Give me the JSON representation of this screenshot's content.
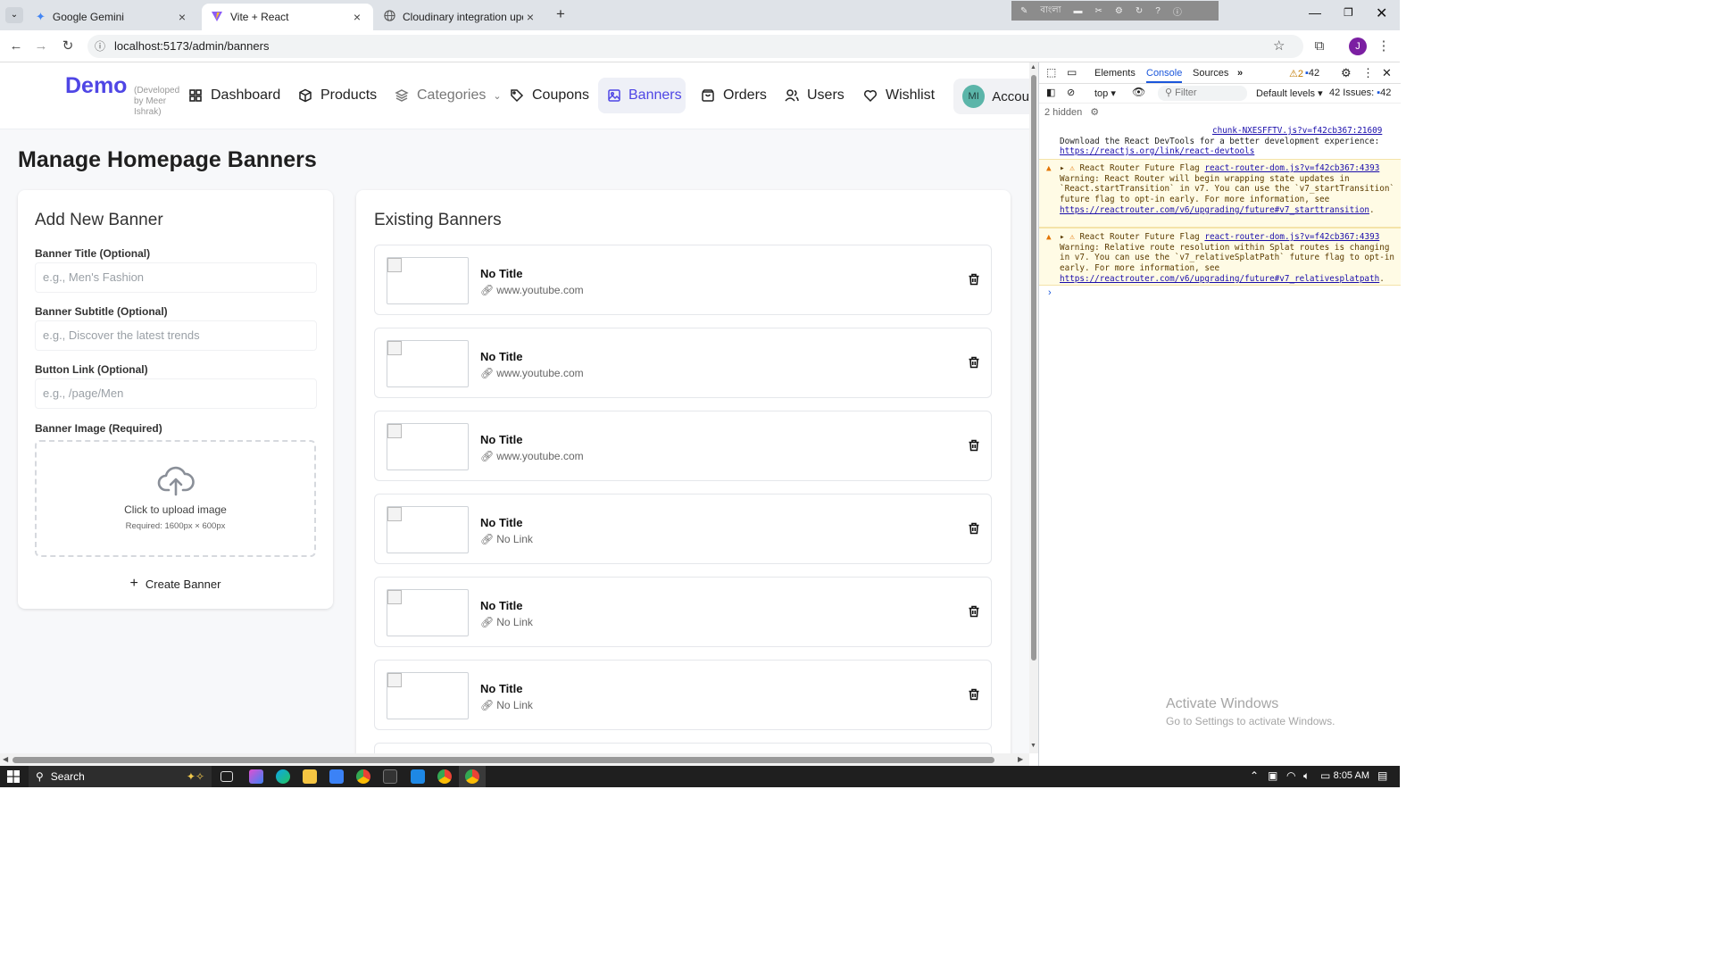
{
  "browser": {
    "tabs": [
      {
        "title": "Google Gemini",
        "active": false
      },
      {
        "title": "Vite + React",
        "active": true
      },
      {
        "title": "Cloudinary integration update",
        "active": false
      }
    ],
    "url": "localhost:5173/admin/banners",
    "profile_initial": "J",
    "lang_label": "বাংলা"
  },
  "app": {
    "brand": "Demo",
    "brand_sub": "(Developed by Meer Ishrak)",
    "nav": [
      {
        "label": "Dashboard",
        "icon": "grid-icon"
      },
      {
        "label": "Products",
        "icon": "box-icon"
      },
      {
        "label": "Categories",
        "icon": "layers-icon"
      },
      {
        "label": "Coupons",
        "icon": "tag-icon"
      },
      {
        "label": "Banners",
        "icon": "image-icon",
        "active": true
      },
      {
        "label": "Orders",
        "icon": "bag-icon"
      },
      {
        "label": "Users",
        "icon": "users-icon"
      },
      {
        "label": "Wishlist",
        "icon": "heart-icon"
      }
    ],
    "account_initials": "MI",
    "account_label": "Accou",
    "page_title": "Manage Homepage Banners",
    "accent": "#4f46e5"
  },
  "form": {
    "heading": "Add New Banner",
    "title_label": "Banner Title (Optional)",
    "title_placeholder": "e.g., Men's Fashion",
    "subtitle_label": "Banner Subtitle (Optional)",
    "subtitle_placeholder": "e.g., Discover the latest trends",
    "link_label": "Button Link (Optional)",
    "link_placeholder": "e.g., /page/Men",
    "image_label": "Banner Image (Required)",
    "upload_text": "Click to upload image",
    "upload_hint": "Required: 1600px × 600px",
    "create_button": "Create Banner"
  },
  "existing": {
    "heading": "Existing Banners",
    "banners": [
      {
        "title": "No Title",
        "link": "www.youtube.com"
      },
      {
        "title": "No Title",
        "link": "www.youtube.com"
      },
      {
        "title": "No Title",
        "link": "www.youtube.com"
      },
      {
        "title": "No Title",
        "link": "No Link"
      },
      {
        "title": "No Title",
        "link": "No Link"
      },
      {
        "title": "No Title",
        "link": "No Link"
      }
    ]
  },
  "devtools": {
    "tabs": [
      "Elements",
      "Console",
      "Sources"
    ],
    "active_tab": "Console",
    "warn_count": "2",
    "msg_count": "42",
    "context": "top",
    "filter_placeholder": "Filter",
    "levels": "Default levels",
    "issues": "42 Issues:",
    "issues_count": "42",
    "hidden": "2 hidden",
    "source_link": "chunk-NXESFFTV.js?v=f42cb367:21609",
    "info_line": "Download the React DevTools for a better development experience:",
    "info_link": "https://reactjs.org/link/react-devtools",
    "warnings": [
      {
        "head": "React Router Future Flag",
        "src": "react-router-dom.js?v=f42cb367:4393",
        "body": "Warning: React Router will begin wrapping state updates in `React.startTransition` in v7. You can use the `v7_startTransition` future flag to opt-in early. For more information, see",
        "url": "https://reactrouter.com/v6/upgrading/future#v7_starttransition"
      },
      {
        "head": "React Router Future Flag",
        "src": "react-router-dom.js?v=f42cb367:4393",
        "body": "Warning: Relative route resolution within Splat routes is changing in v7. You can use the `v7_relativeSplatPath` future flag to opt-in early. For more information, see",
        "url": "https://reactrouter.com/v6/upgrading/future#v7_relativesplatpath"
      }
    ],
    "watermark_title": "Activate Windows",
    "watermark_sub": "Go to Settings to activate Windows."
  },
  "taskbar": {
    "search": "Search",
    "time": "8:05 AM"
  }
}
